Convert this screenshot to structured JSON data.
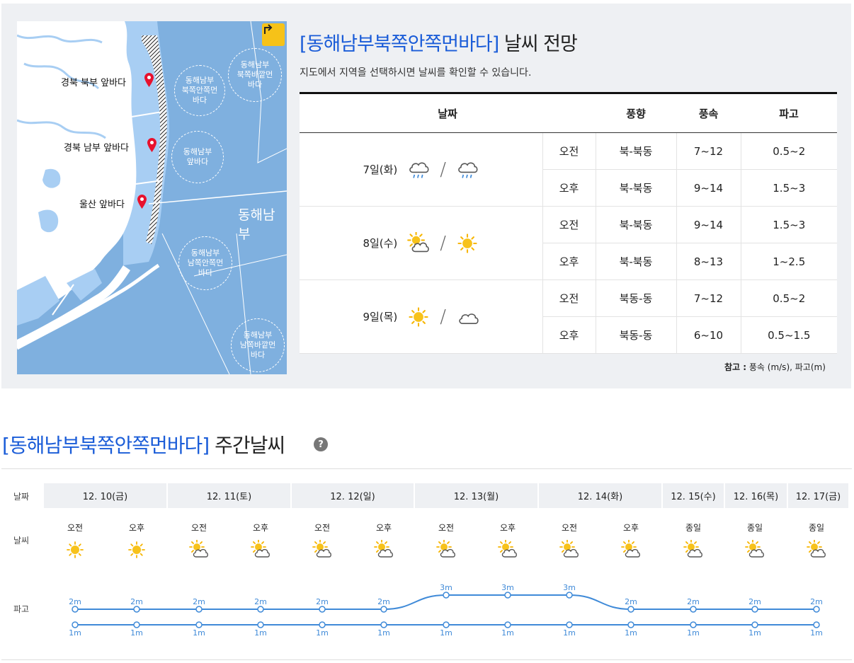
{
  "forecast": {
    "title_region": "[동해남부북쪽안쪽먼바다]",
    "title_suffix": "날씨 전망",
    "subtitle": "지도에서 지역을 선택하시면 날씨를 확인할 수 있습니다.",
    "headers": [
      "날짜",
      "풍향",
      "풍속",
      "파고"
    ],
    "days": [
      {
        "date": "7일(화)",
        "am_icon": "rain-icon",
        "pm_icon": "rain-icon",
        "rows": [
          {
            "period": "오전",
            "wind_dir": "북-북동",
            "wind_speed": "7~12",
            "wave": "0.5~2"
          },
          {
            "period": "오후",
            "wind_dir": "북-북동",
            "wind_speed": "9~14",
            "wave": "1.5~3"
          }
        ]
      },
      {
        "date": "8일(수)",
        "am_icon": "sun-cloud-icon",
        "pm_icon": "sun-icon",
        "rows": [
          {
            "period": "오전",
            "wind_dir": "북-북동",
            "wind_speed": "9~14",
            "wave": "1.5~3"
          },
          {
            "period": "오후",
            "wind_dir": "북-북동",
            "wind_speed": "8~13",
            "wave": "1~2.5"
          }
        ]
      },
      {
        "date": "9일(목)",
        "am_icon": "sun-icon",
        "pm_icon": "cloud-icon",
        "rows": [
          {
            "period": "오전",
            "wind_dir": "북동-동",
            "wind_speed": "7~12",
            "wave": "0.5~2"
          },
          {
            "period": "오후",
            "wind_dir": "북동-동",
            "wind_speed": "6~10",
            "wave": "0.5~1.5"
          }
        ]
      }
    ],
    "note_label": "참고 :",
    "note_text": " 풍속 (m/s), 파고(m)"
  },
  "map": {
    "coast_labels": [
      "경북 북부 앞바다",
      "경북 남부 앞바다",
      "울산 앞바다"
    ],
    "zones": [
      "동해남부\n북쪽안쪽먼\n바다",
      "동해남부\n북쪽바깥먼\n바다",
      "동해남부\n앞바다",
      "동해남부\n남쪽안쪽먼\n바다",
      "동해남부\n남쪽바깥먼\n바다"
    ],
    "sea_name": "동해남부",
    "reset_icon": "reset-arrow-icon",
    "colors": {
      "sea": "#7fb0df",
      "inshore": "#a8cef3",
      "land": "#ffffff",
      "pin": "#e8112d"
    }
  },
  "weekly": {
    "title_region": "[동해남부북쪽안쪽먼바다]",
    "title_suffix": "주간날씨",
    "help_icon": "question-circle-icon",
    "help_glyph": "?",
    "labels": {
      "date": "날짜",
      "weather": "날씨",
      "wave": "파고"
    },
    "dates": [
      "12. 10(금)",
      "12. 11(토)",
      "12. 12(일)",
      "12. 13(월)",
      "12. 14(화)",
      "12. 15(수)",
      "12. 16(목)",
      "12. 17(금)"
    ],
    "slots": [
      {
        "tod": "오전",
        "icon": "sun-icon",
        "wave_max": "2m",
        "wave_min": "1m",
        "max": 2,
        "min": 1
      },
      {
        "tod": "오후",
        "icon": "sun-icon",
        "wave_max": "2m",
        "wave_min": "1m",
        "max": 2,
        "min": 1
      },
      {
        "tod": "오전",
        "icon": "sun-cloud-icon",
        "wave_max": "2m",
        "wave_min": "1m",
        "max": 2,
        "min": 1
      },
      {
        "tod": "오후",
        "icon": "sun-cloud-icon",
        "wave_max": "2m",
        "wave_min": "1m",
        "max": 2,
        "min": 1
      },
      {
        "tod": "오전",
        "icon": "sun-cloud-icon",
        "wave_max": "2m",
        "wave_min": "1m",
        "max": 2,
        "min": 1
      },
      {
        "tod": "오후",
        "icon": "sun-cloud-icon",
        "wave_max": "2m",
        "wave_min": "1m",
        "max": 2,
        "min": 1
      },
      {
        "tod": "오전",
        "icon": "sun-cloud-icon",
        "wave_max": "3m",
        "wave_min": "1m",
        "max": 3,
        "min": 1
      },
      {
        "tod": "오후",
        "icon": "sun-cloud-icon",
        "wave_max": "3m",
        "wave_min": "1m",
        "max": 3,
        "min": 1
      },
      {
        "tod": "오전",
        "icon": "sun-cloud-icon",
        "wave_max": "3m",
        "wave_min": "1m",
        "max": 3,
        "min": 1
      },
      {
        "tod": "오후",
        "icon": "sun-cloud-icon",
        "wave_max": "2m",
        "wave_min": "1m",
        "max": 2,
        "min": 1
      },
      {
        "tod": "종일",
        "icon": "sun-cloud-icon",
        "wave_max": "2m",
        "wave_min": "1m",
        "max": 2,
        "min": 1
      },
      {
        "tod": "종일",
        "icon": "sun-cloud-icon",
        "wave_max": "2m",
        "wave_min": "1m",
        "max": 2,
        "min": 1
      },
      {
        "tod": "종일",
        "icon": "sun-cloud-icon",
        "wave_max": "2m",
        "wave_min": "1m",
        "max": 2,
        "min": 1
      }
    ],
    "colors": {
      "line": "#3f8ad8",
      "date_bg": "#eef0f3"
    }
  }
}
